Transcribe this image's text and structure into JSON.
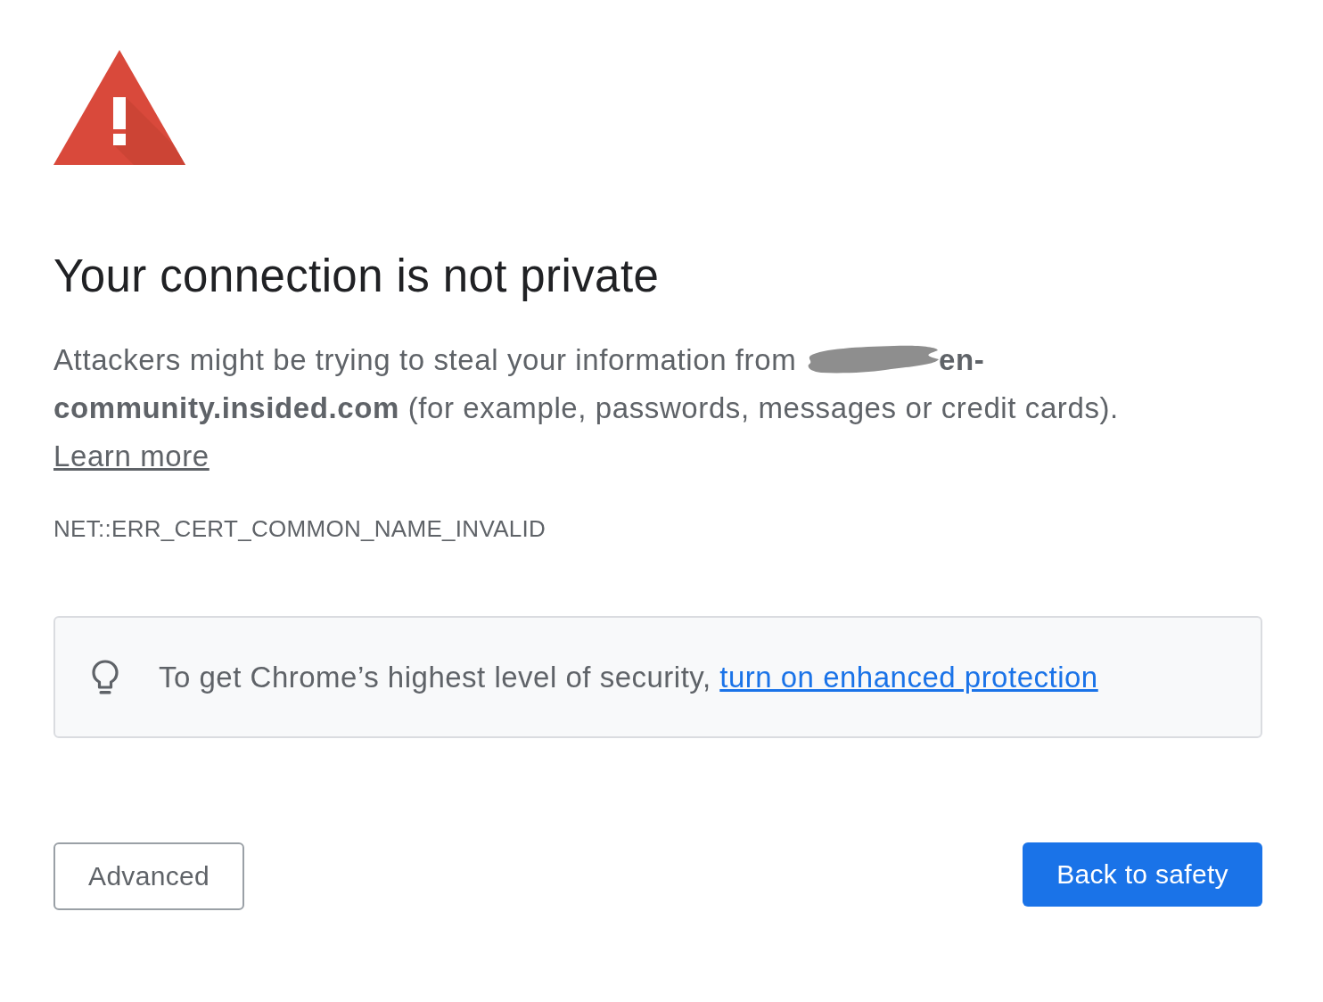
{
  "heading": "Your connection is not private",
  "message": {
    "text_before": "Attackers might be trying to steal your information from",
    "host_redacted": true,
    "host": "en-community.insided.com",
    "text_after": "(for example, passwords, messages or credit cards).",
    "link": "Learn more"
  },
  "error_code": "NET::ERR_CERT_COMMON_NAME_INVALID",
  "tip": {
    "text": "To get Chrome’s highest level of security,",
    "link": "turn on enhanced protection"
  },
  "buttons": [
    {
      "label": "Advanced",
      "kind": "secondary"
    },
    {
      "label": "Back to safety",
      "kind": "primary"
    }
  ]
}
